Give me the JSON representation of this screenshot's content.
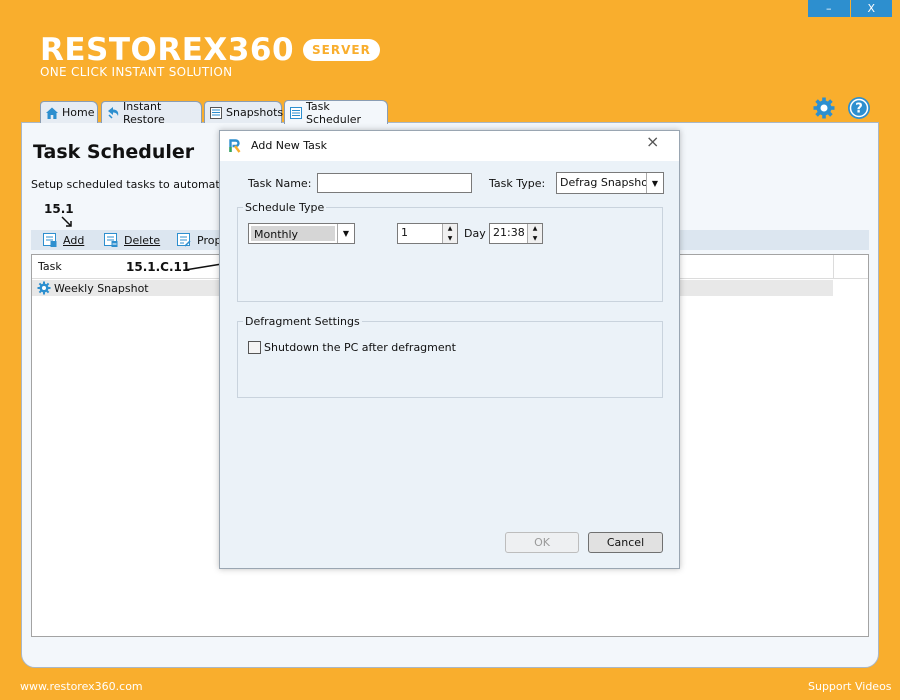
{
  "window": {
    "minimize_label": "–",
    "close_label": "X"
  },
  "brand": {
    "name": "RESTOREX360",
    "badge": "SERVER",
    "tagline": "ONE CLICK INSTANT SOLUTION"
  },
  "tabs": [
    {
      "label": "Home"
    },
    {
      "label": "Instant Restore"
    },
    {
      "label": "Snapshots"
    },
    {
      "label": "Task Scheduler"
    }
  ],
  "page": {
    "title": "Task Scheduler",
    "description": "Setup scheduled tasks to automatically"
  },
  "toolbar": {
    "add": "Add",
    "delete": "Delete",
    "properties": "Prop"
  },
  "annotations": {
    "add_step": "15.1",
    "schedule_step": "15.1.C.11"
  },
  "table": {
    "header": "Task",
    "rows": [
      {
        "name": "Weekly Snapshot"
      }
    ]
  },
  "dialog": {
    "title": "Add New Task",
    "close_label": "×",
    "task_name_label": "Task Name:",
    "task_name_value": "",
    "task_type_label": "Task Type:",
    "task_type_value": "Defrag Snapshots",
    "schedule_group": "Schedule Type",
    "schedule_value": "Monthly",
    "day_value": "1",
    "day_label": "Day",
    "time_value": "21:38",
    "defrag_group": "Defragment Settings",
    "shutdown_label": "Shutdown the PC after defragment",
    "shutdown_checked": false,
    "ok_label": "OK",
    "cancel_label": "Cancel"
  },
  "footer": {
    "website": "www.restorex360.com",
    "support": "Support Videos"
  },
  "colors": {
    "brand_orange": "#f9ae2d",
    "accent_blue": "#2d8fcf"
  }
}
